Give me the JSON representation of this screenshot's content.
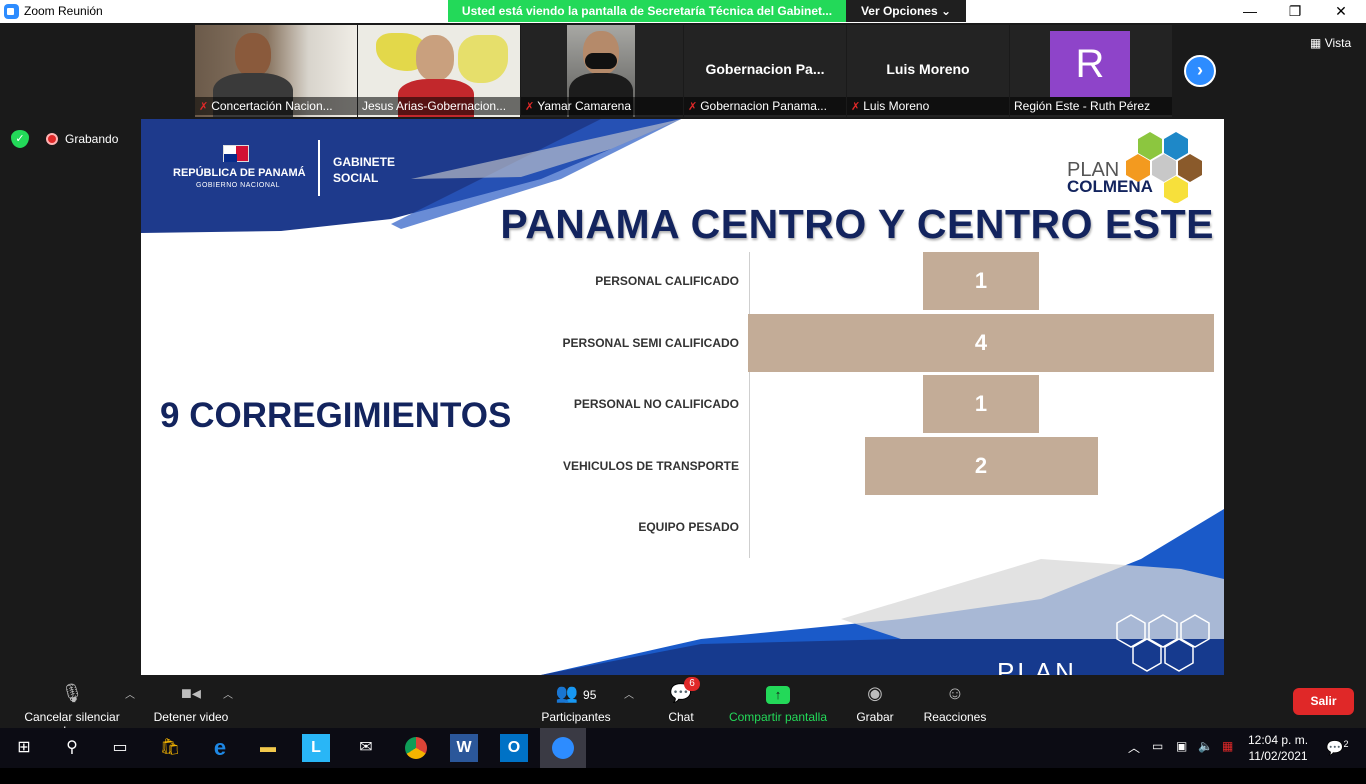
{
  "window": {
    "title": "Zoom Reunión",
    "share_banner": "Usted está viendo la pantalla de Secretaría Técnica del Gabinet...",
    "view_options": "Ver Opciones",
    "minimize": "—",
    "maximize": "❐",
    "close": "✕"
  },
  "participants_strip": {
    "vista": "Vista",
    "tiles": [
      {
        "name": "Concertación Nacion...",
        "muted": true,
        "type": "video"
      },
      {
        "name": "Jesus Arias-Gobernacion...",
        "muted": false,
        "type": "video",
        "active": true
      },
      {
        "name": "Yamar Camarena",
        "muted": true,
        "type": "video"
      },
      {
        "name": "Gobernacion Panama...",
        "big_name": "Gobernacion  Pa...",
        "muted": true,
        "type": "name"
      },
      {
        "name": "Luis Moreno",
        "big_name": "Luis Moreno",
        "muted": true,
        "type": "name"
      },
      {
        "name": "Región Este - Ruth Pérez",
        "avatar_letter": "R",
        "muted": false,
        "type": "avatar",
        "avatar_color": "#8e44c9"
      }
    ]
  },
  "recording": {
    "label": "Grabando"
  },
  "slide": {
    "gov_name": "REPÚBLICA DE PANAMÁ",
    "gov_sub": "GOBIERNO NACIONAL",
    "cabinet": "GABINETE",
    "cabinet2": "SOCIAL",
    "plan": "PLAN",
    "colmena": "COLMENA",
    "title": "PANAMA CENTRO Y CENTRO ESTE",
    "corregimientos": "9 CORREGIMIENTOS",
    "plan_bottom": "PLAN"
  },
  "chart_data": {
    "type": "bar",
    "orientation": "horizontal-centered",
    "categories": [
      "PERSONAL CALIFICADO",
      "PERSONAL SEMI CALIFICADO",
      "PERSONAL NO CALIFICADO",
      "VEHICULOS DE TRANSPORTE",
      "EQUIPO PESADO"
    ],
    "values": [
      1,
      4,
      1,
      2,
      0
    ],
    "data_labels": [
      "1",
      "4",
      "1",
      "2",
      ""
    ],
    "bar_color": "#c3ac97",
    "xlim": [
      0,
      4
    ]
  },
  "toolbar": {
    "mute_label": "Cancelar silenciar ahora",
    "video_label": "Detener video",
    "participants_label": "Participantes",
    "participants_count": "95",
    "chat_label": "Chat",
    "chat_badge": "6",
    "share_label": "Compartir pantalla",
    "record_label": "Grabar",
    "reactions_label": "Reacciones",
    "leave_label": "Salir"
  },
  "taskbar": {
    "time": "12:04 p. m.",
    "date": "11/02/2021",
    "notifications": "2"
  }
}
